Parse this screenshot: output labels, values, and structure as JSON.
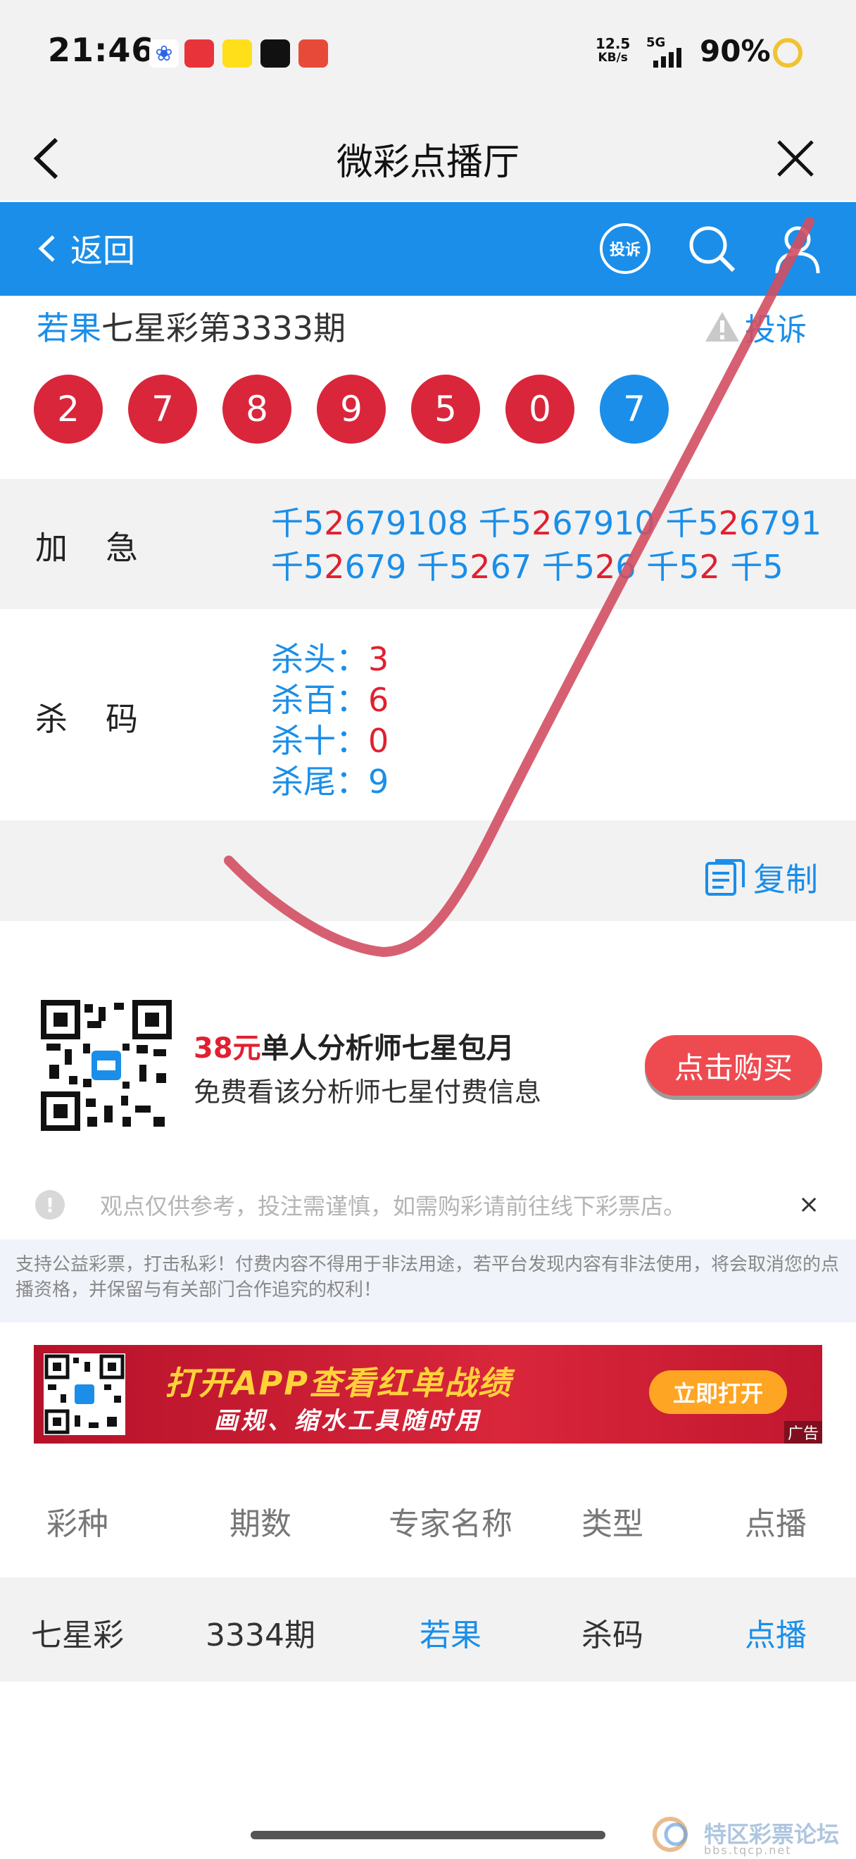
{
  "status_bar": {
    "time": "21:46",
    "notif_icons": [
      "baidu-icon",
      "toutiao-icon",
      "xianyu-icon",
      "dewu-icon",
      "pinduoduo-icon"
    ],
    "net_speed_value": "12.5",
    "net_speed_unit": "KB/s",
    "network": "5G",
    "battery": "90%"
  },
  "app_header": {
    "title": "微彩点播厅"
  },
  "nav": {
    "back_label": "返回",
    "complaint_icon_text": "投诉"
  },
  "issue": {
    "expert": "若果",
    "title_rest": "七星彩第3333期",
    "complain_label": "投诉"
  },
  "draw_numbers": [
    "2",
    "7",
    "8",
    "9",
    "5",
    "0",
    "7"
  ],
  "colors": {
    "accent_blue": "#1a8ee9",
    "ball_red": "#d9263b",
    "highlight_red": "#e02030"
  },
  "rows": {
    "jiaji": {
      "label": "加急",
      "line1": [
        {
          "pre": "千5",
          "hl": "2",
          "post": "679108"
        },
        {
          "pre": "千5",
          "hl": "2",
          "post": "67910"
        },
        {
          "pre": "千5",
          "hl": "2",
          "post": "6791"
        }
      ],
      "line2": [
        {
          "pre": "千5",
          "hl": "2",
          "post": "679"
        },
        {
          "pre": "千5",
          "hl": "2",
          "post": "67"
        },
        {
          "pre": "千5",
          "hl": "2",
          "post": "6"
        },
        {
          "pre": "千5",
          "hl": "2",
          "post": ""
        },
        {
          "pre": "千5",
          "hl": "",
          "post": ""
        }
      ]
    },
    "shama": {
      "label": "杀码",
      "items": [
        {
          "key": "杀头：",
          "value": "3",
          "hit": false
        },
        {
          "key": "杀百：",
          "value": "6",
          "hit": false
        },
        {
          "key": "杀十：",
          "value": "0",
          "hit": false
        },
        {
          "key": "杀尾：",
          "value": "9",
          "hit": true
        }
      ]
    }
  },
  "copy_label": "复制",
  "promo": {
    "price": "38元",
    "title_rest": "单人分析师七星包月",
    "subtitle": "免费看该分析师七星付费信息",
    "buy_label": "点击购买"
  },
  "notice": {
    "text": "观点仅供参考，投注需谨慎，如需购彩请前往线下彩票店。",
    "close": "×"
  },
  "disclaimer": "支持公益彩票，打击私彩！付费内容不得用于非法用途，若平台发现内容有非法使用，将会取消您的点播资格，并保留与有关部门合作追究的权利！",
  "banner": {
    "title": "打开APP查看红单战绩",
    "subtitle": "画规、缩水工具随时用",
    "button": "立即打开",
    "ad_tag": "广告"
  },
  "table": {
    "headers": [
      "彩种",
      "期数",
      "专家名称",
      "类型",
      "点播"
    ],
    "rows": [
      [
        "七星彩",
        "3334期",
        "若果",
        "杀码",
        "点播"
      ]
    ]
  },
  "watermark": {
    "name": "特区彩票论坛",
    "domain": "bbs.tqcp.net"
  }
}
